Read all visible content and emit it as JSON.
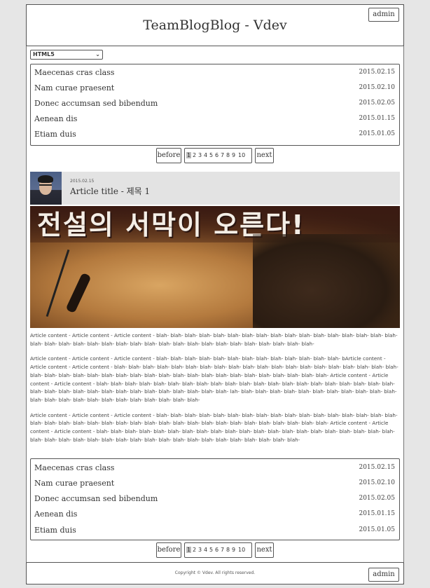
{
  "site_title": "TeamBlogBlog - Vdev",
  "admin_label": "admin",
  "category_select": {
    "value": "HTML5"
  },
  "posts": [
    {
      "title": "Maecenas cras class",
      "date": "2015.02.15"
    },
    {
      "title": "Nam curae praesent",
      "date": "2015.02.10"
    },
    {
      "title": "Donec accumsan sed bibendum",
      "date": "2015.02.05"
    },
    {
      "title": "Aenean dis",
      "date": "2015.01.15"
    },
    {
      "title": "Etiam duis",
      "date": "2015.01.05"
    }
  ],
  "pager": {
    "before": "before",
    "next": "next",
    "pages": [
      "1",
      "2",
      "3",
      "4",
      "5",
      "6",
      "7",
      "8",
      "9",
      "10"
    ],
    "current": "1"
  },
  "article": {
    "date": "2015.02.15",
    "title": "Article title - 제목 1",
    "image_text": "전설의 서막이 오른다!",
    "paragraphs": [
      "Article content - Article content - Article content - blah- blah- blah- blah- blah- blah- blah- blah- blah- blah- blah- blah- blah- blah- blah- blah- blah- blah- blah- blah- blah- blah- blah- blah- blah- blah- blah- blah- blah- blah- blah- blah- blah- blah- blah- blah- blah-",
      "Article content - Article content - Article content - blah- blah- blah- blah- blah- blah- blah- blah- blah- blah- blah- blah- blah- bArticle content - Article content - Article content - blah- blah- blah- blah- blah- blah- blah- blah- blah- blah- blah- blah- blah- blah- blah- blah- blah- blah- blah- blah- blah- blah- blah- blah- blah- blah- blah- blah- blah- blah- blah- blah- blah- blah- blah- blah- blah- blah- blah- blah- blah- Article content - Article content - Article content - blah- blah- blah- blah- blah- blah- blah- blah- blah- blah- blah- blah- blah- blah- blah- blah- blah- blah- blah- blah- blah- blah- blah- blah- blah- blah- blah- blah- blah- blah- blah- blah- blah- blah- blah- lah- blah- blah- blah- blah- blah- blah- blah- blah- blah- blah- blah- blah- blah- blah- blah- blah- blah- blah- blah- blah- blah- blah- blah-",
      "Article content - Article content - Article content - blah- blah- blah- blah- blah- blah- blah- blah- blah- blah- blah- blah- blah- blah- blah- blah- blah- blah- blah- blah- blah- blah- blah- blah- blah- blah- blah- blah- blah- blah- blah- blah- blah- blah- blah- blah- blah- blah- Article content - Article content - Article content - blah- blah- blah- blah- blah- blah- blah- blah- blah- blah- blah- blah- blah- blah- blah- blah- blah- blah- blah- blah- blah- blah- blah- blah- blah- blah- blah- blah- blah- blah- blah- blah- blah- blah- blah- blah- blah- blah- blah- blah-"
    ]
  },
  "footer": {
    "copyright": "Copyright © Vdev. All rights reserved."
  }
}
